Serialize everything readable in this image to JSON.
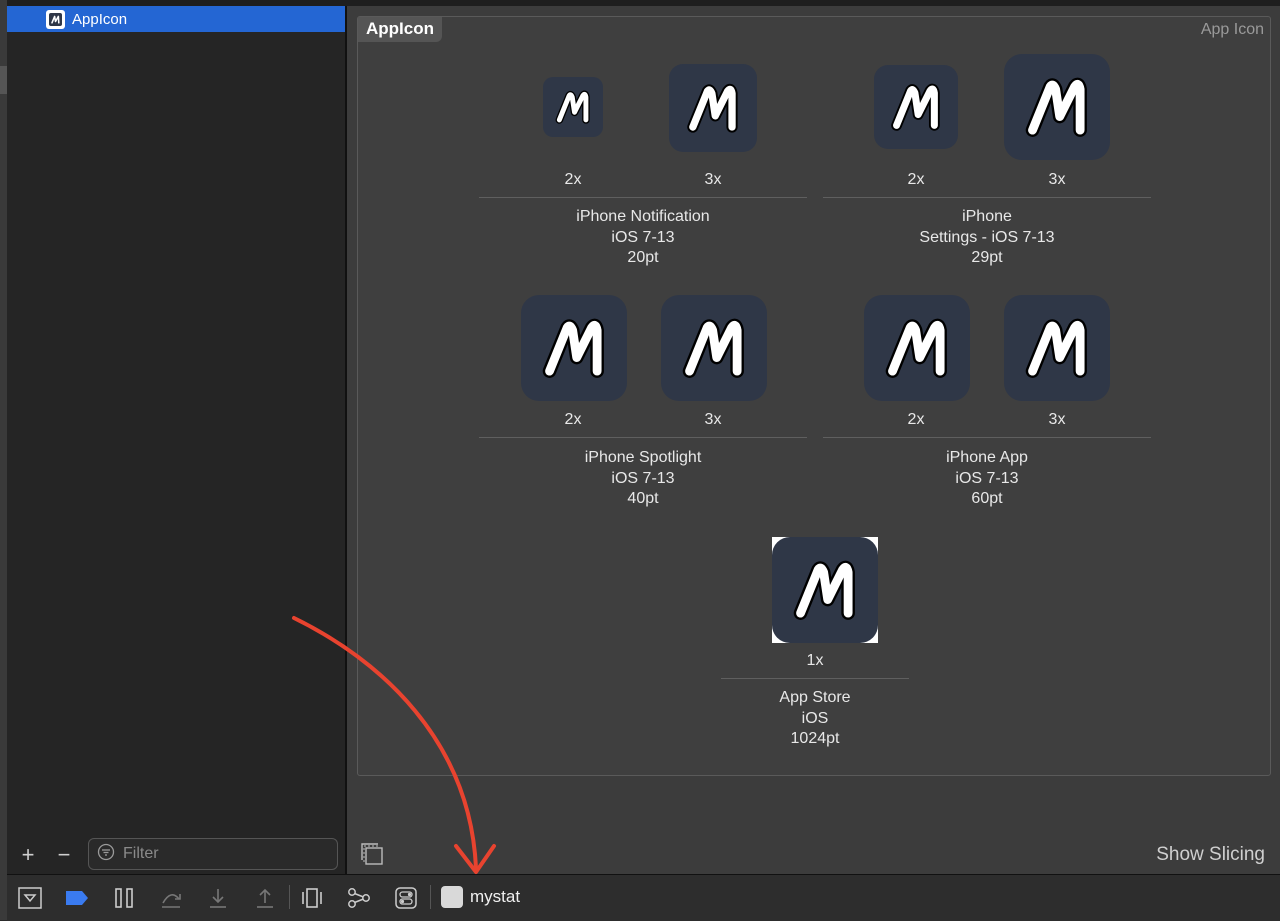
{
  "sidebar": {
    "asset_name": "AppIcon",
    "filter_placeholder": "Filter",
    "add_label": "+",
    "remove_label": "−"
  },
  "asset_set": {
    "name": "AppIcon",
    "type": "App Icon",
    "groups": [
      {
        "scales": [
          "2x",
          "3x"
        ],
        "lines": [
          "iPhone Notification",
          "iOS 7-13",
          "20pt"
        ]
      },
      {
        "scales": [
          "2x",
          "3x"
        ],
        "lines": [
          "iPhone",
          "Settings - iOS 7-13",
          "29pt"
        ]
      },
      {
        "scales": [
          "2x",
          "3x"
        ],
        "lines": [
          "iPhone Spotlight",
          "iOS 7-13",
          "40pt"
        ]
      },
      {
        "scales": [
          "2x",
          "3x"
        ],
        "lines": [
          "iPhone App",
          "iOS 7-13",
          "60pt"
        ]
      },
      {
        "scales": [
          "1x"
        ],
        "lines": [
          "App Store",
          "iOS",
          "1024pt"
        ]
      }
    ]
  },
  "footer": {
    "show_slicing": "Show Slicing"
  },
  "debugbar": {
    "scheme": "mystat"
  },
  "colors": {
    "selection": "#2466d3",
    "icon_bg": "#2f3747",
    "annotation_arrow": "#e8432f"
  },
  "icons": {
    "app_icon_glyph": "M",
    "filter": "filter-icon",
    "slicing": "slicing-icon"
  }
}
